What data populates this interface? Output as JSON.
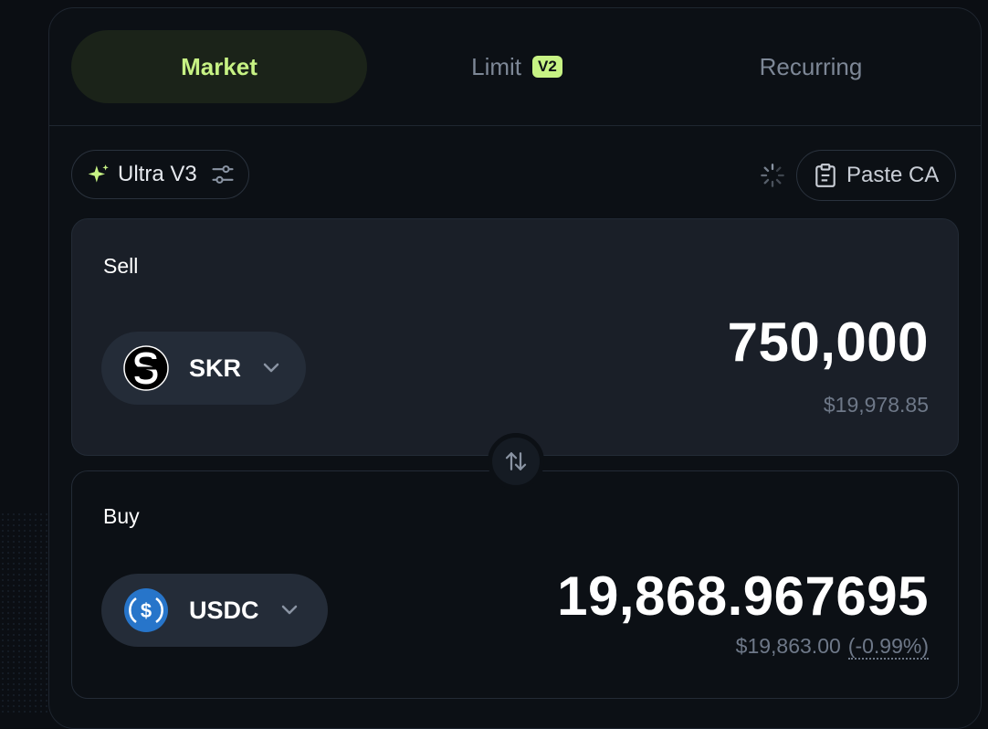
{
  "tabs": [
    {
      "label": "Market",
      "active": true
    },
    {
      "label": "Limit",
      "badge": "V2",
      "active": false
    },
    {
      "label": "Recurring",
      "active": false
    }
  ],
  "toolbar": {
    "router_label": "Ultra V3",
    "paste_label": "Paste CA"
  },
  "sell": {
    "label": "Sell",
    "token": "SKR",
    "amount": "750,000",
    "usd_value": "$19,978.85"
  },
  "buy": {
    "label": "Buy",
    "token": "USDC",
    "amount": "19,868.967695",
    "usd_value": "$19,863.00",
    "price_impact": "(-0.99%)"
  },
  "colors": {
    "accent": "#c7f284",
    "usdc_blue": "#2775ca",
    "background": "#0c1015",
    "sell_card": "#1a1f28"
  },
  "icons": {
    "sparkle": "sparkle-icon",
    "settings": "sliders-icon",
    "loading": "spinner-icon",
    "paste": "clipboard-icon",
    "swap": "swap-arrows-icon",
    "dropdown": "chevron-down-icon"
  }
}
